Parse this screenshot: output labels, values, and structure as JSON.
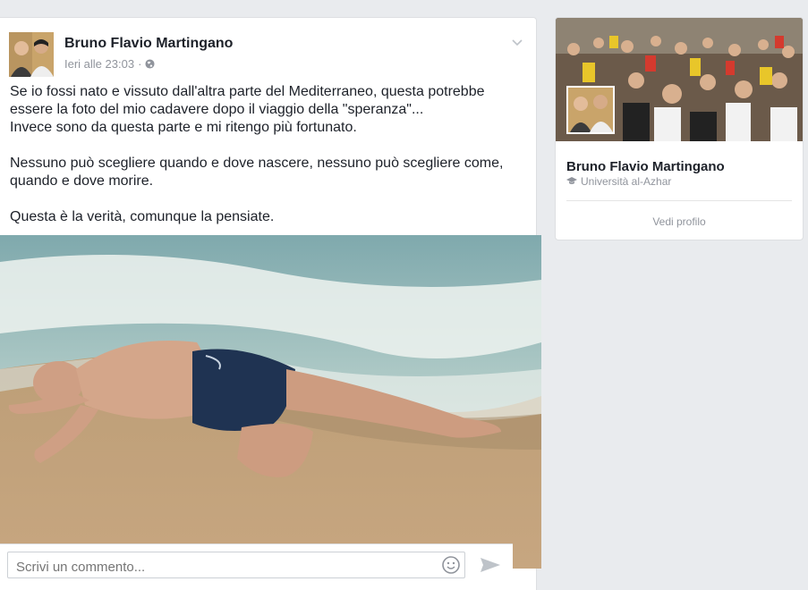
{
  "post": {
    "author": "Bruno Flavio Martingano",
    "timestamp": "Ieri alle 23:03",
    "separator": "·",
    "privacy_icon": "globe-icon",
    "menu_icon": "chevron-down-icon",
    "paragraph1": "Se io fossi nato e vissuto dall'altra parte del Mediterraneo, questa potrebbe essere la foto del mio cadavere dopo il viaggio della \"speranza\"...\nInvece sono da questa parte e mi ritengo più fortunato.",
    "paragraph2": "Nessuno può scegliere quando e dove nascere, nessuno può scegliere come, quando e dove morire.",
    "paragraph3": "Questa è la verità, comunque la pensiate."
  },
  "comment": {
    "placeholder": "Scrivi un commento...",
    "emoji_icon": "smiley-icon",
    "send_icon": "send-icon"
  },
  "profile_card": {
    "name": "Bruno Flavio Martingano",
    "school_icon": "graduation-cap-icon",
    "school": "Università al-Azhar",
    "link": "Vedi profilo"
  },
  "colors": {
    "background": "#e9ebee",
    "text": "#1d2129",
    "muted": "#90949c"
  }
}
